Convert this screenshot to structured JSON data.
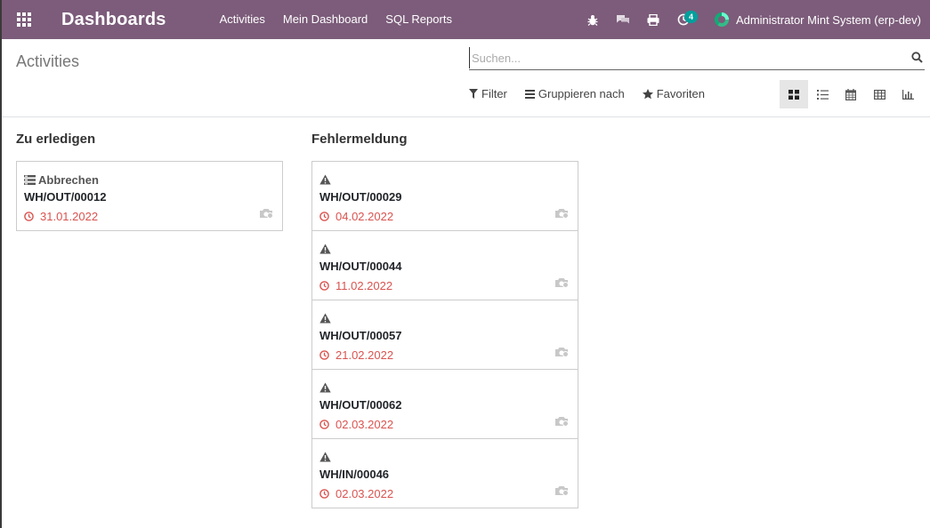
{
  "navbar": {
    "brand": "Dashboards",
    "menu": [
      "Activities",
      "Mein Dashboard",
      "SQL Reports"
    ],
    "activity_count": "4",
    "user": "Administrator Mint System (erp-dev)",
    "color": "#7c5c7a"
  },
  "control": {
    "breadcrumb": "Activities",
    "search_placeholder": "Suchen...",
    "filter_label": "Filter",
    "group_label": "Gruppieren nach",
    "favorites_label": "Favoriten"
  },
  "columns": [
    {
      "title": "Zu erledigen",
      "cards": [
        {
          "tag": "Abbrechen",
          "icon": "list-icon",
          "ref": "WH/OUT/00012",
          "date": "31.01.2022"
        }
      ]
    },
    {
      "title": "Fehlermeldung",
      "cards": [
        {
          "tag": "",
          "icon": "warning-icon",
          "ref": "WH/OUT/00029",
          "date": "04.02.2022"
        },
        {
          "tag": "",
          "icon": "warning-icon",
          "ref": "WH/OUT/00044",
          "date": "11.02.2022"
        },
        {
          "tag": "",
          "icon": "warning-icon",
          "ref": "WH/OUT/00057",
          "date": "21.02.2022"
        },
        {
          "tag": "",
          "icon": "warning-icon",
          "ref": "WH/OUT/00062",
          "date": "02.03.2022"
        },
        {
          "tag": "",
          "icon": "warning-icon",
          "ref": "WH/IN/00046",
          "date": "02.03.2022"
        }
      ]
    }
  ],
  "colors": {
    "deadline": "#d9534f",
    "badge": "#00a09d"
  }
}
